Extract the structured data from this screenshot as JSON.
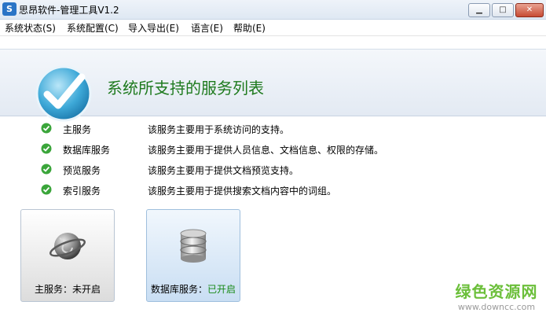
{
  "window": {
    "title": "思昂软件-管理工具V1.2",
    "icon_text": "S",
    "min_icon": "minimize-icon",
    "max_icon": "maximize-icon",
    "close_icon": "close-icon"
  },
  "menu": [
    {
      "label": "系统状态(S)"
    },
    {
      "label": "系统配置(C)"
    },
    {
      "label": "导入导出(E)"
    },
    {
      "label": "语言(E)"
    },
    {
      "label": "帮助(E)"
    }
  ],
  "banner": {
    "title": "系统所支持的服务列表",
    "icon": "checkmark-logo-icon"
  },
  "services": [
    {
      "name": "主服务",
      "desc": "该服务主要用于系统访问的支持。",
      "status_icon": "check-circle-icon"
    },
    {
      "name": "数据库服务",
      "desc": "该服务主要用于提供人员信息、文档信息、权限的存储。",
      "status_icon": "check-circle-icon"
    },
    {
      "name": "预览服务",
      "desc": "该服务主要用于提供文档预览支持。",
      "status_icon": "check-circle-icon"
    },
    {
      "name": "索引服务",
      "desc": "该服务主要用于提供搜索文档内容中的词组。",
      "status_icon": "check-circle-icon"
    }
  ],
  "cards": {
    "main": {
      "label": "主服务：",
      "status": "未开启",
      "icon": "globe-icon"
    },
    "db": {
      "label": "数据库服务：",
      "status": "已开启",
      "icon": "database-icon"
    }
  },
  "watermark": {
    "text": "绿色资源网",
    "url": "www.downcc.com"
  },
  "colors": {
    "accent": "#1e7a1e",
    "status_on": "#188a18",
    "check": "#3aa53a"
  }
}
